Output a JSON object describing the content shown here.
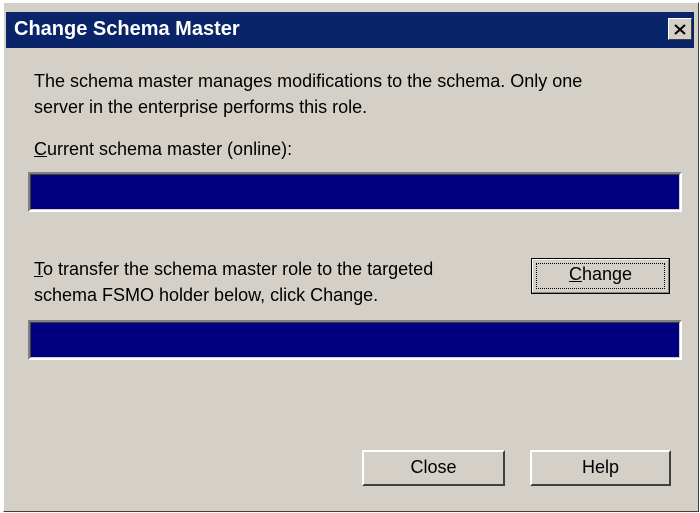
{
  "dialog": {
    "title": "Change Schema Master",
    "description_line1": "The schema master manages modifications to the schema. Only one",
    "description_line2": "server in the enterprise performs this role.",
    "current_label_mn": "C",
    "current_label_rest": "urrent schema master (online):",
    "current_value": "",
    "transfer_line1_mn": "T",
    "transfer_line1_rest": "o transfer the schema master role to the targeted",
    "transfer_line2": "schema FSMO holder below, click Change.",
    "target_value": "",
    "change_mn": "C",
    "change_rest": "hange",
    "close_label": "Close",
    "help_label": "Help"
  },
  "colors": {
    "titlebar": "#0a246a",
    "field": "#000080",
    "face": "#d4d0c8"
  },
  "icons": {
    "close": "close-icon"
  }
}
